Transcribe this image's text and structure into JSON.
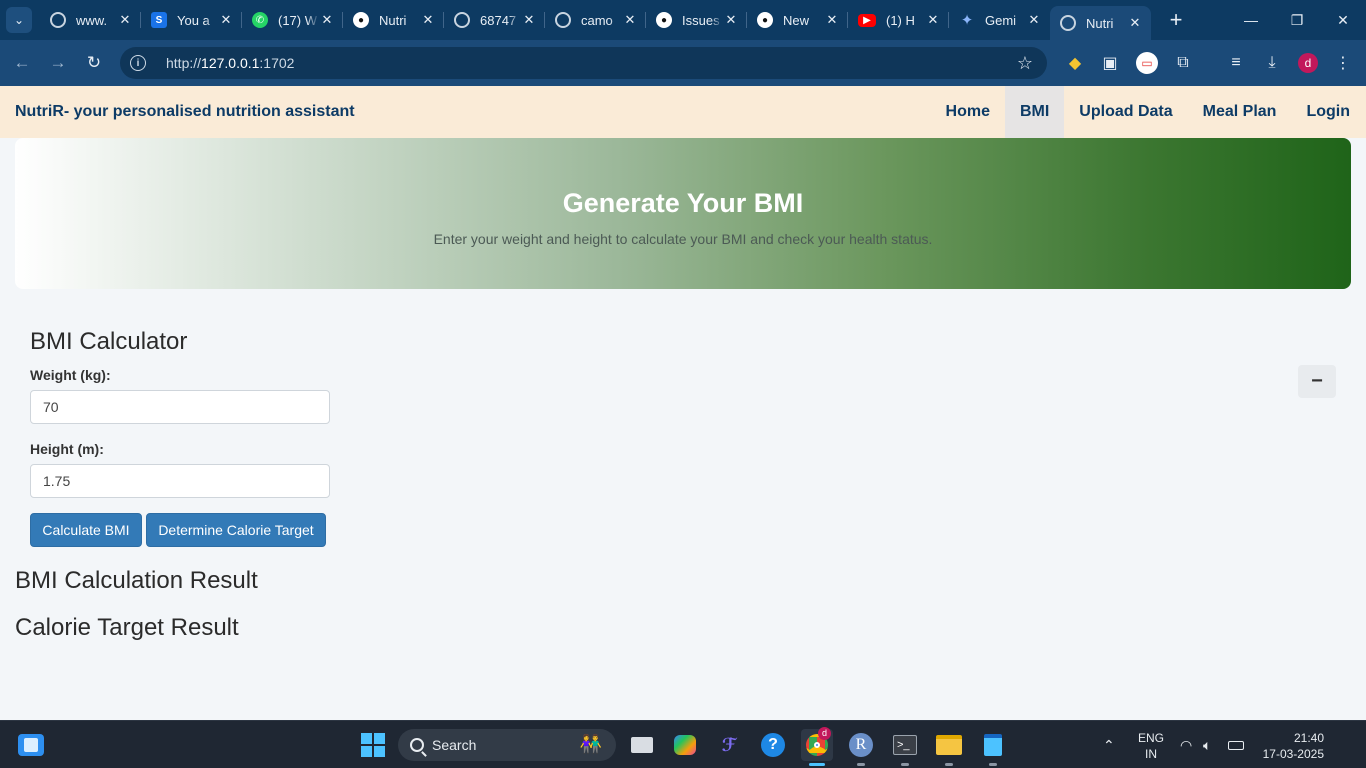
{
  "browser": {
    "tabs": [
      {
        "title": "www.",
        "icon": "globe-icon"
      },
      {
        "title": "You a",
        "icon": "s-icon"
      },
      {
        "title": "(17) W",
        "icon": "whatsapp-icon"
      },
      {
        "title": "Nutri",
        "icon": "github-icon"
      },
      {
        "title": "68747",
        "icon": "globe-icon"
      },
      {
        "title": "camo",
        "icon": "globe-icon"
      },
      {
        "title": "Issues",
        "icon": "github-icon"
      },
      {
        "title": "New",
        "icon": "github-icon"
      },
      {
        "title": "(1) H",
        "icon": "youtube-icon"
      },
      {
        "title": "Gemi",
        "icon": "gemini-icon"
      },
      {
        "title": "Nutri",
        "icon": "globe-icon"
      }
    ],
    "url_prefix": "http://",
    "url_host": "127.0.0.1",
    "url_port": ":1702",
    "profile_initial": "d"
  },
  "page": {
    "brand": "NutriR- your personalised nutrition assistant",
    "nav": {
      "home": "Home",
      "bmi": "BMI",
      "upload": "Upload Data",
      "meal_plan": "Meal Plan",
      "login": "Login"
    },
    "hero": {
      "title": "Generate Your BMI",
      "subtitle": "Enter your weight and height to calculate your BMI and check your health status."
    },
    "calculator": {
      "title": "BMI Calculator",
      "weight_label": "Weight (kg):",
      "weight_value": "70",
      "height_label": "Height (m):",
      "height_value": "1.75",
      "calculate_label": "Calculate BMI",
      "calorie_label": "Determine Calorie Target",
      "collapse_label": "−"
    },
    "results": {
      "bmi_heading": "BMI Calculation Result",
      "calorie_heading": "Calorie Target Result"
    }
  },
  "taskbar": {
    "search_label": "Search",
    "lang_line1": "ENG",
    "lang_line2": "IN",
    "time": "21:40",
    "date": "17-03-2025",
    "chrome_badge": "d"
  },
  "colors": {
    "nav_bg": "#faebd7",
    "brand_text": "#0d3b66",
    "button": "#337ab7",
    "hero_end": "#1f6419"
  }
}
